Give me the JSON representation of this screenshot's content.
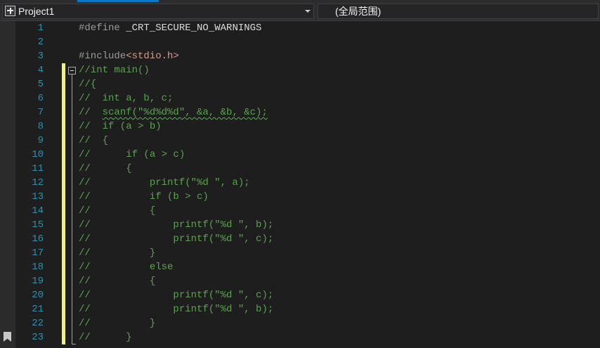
{
  "navigation_bar": {
    "project_label": "Project1",
    "scope_label": "(全局范围)"
  },
  "editor": {
    "lines": [
      {
        "n": "1",
        "tokens": [
          {
            "t": "#define ",
            "c": "kw"
          },
          {
            "t": "_CRT_SECURE_NO_WARNINGS",
            "c": "plain"
          }
        ]
      },
      {
        "n": "2",
        "tokens": []
      },
      {
        "n": "3",
        "tokens": [
          {
            "t": "#include",
            "c": "kw"
          },
          {
            "t": "<stdio.h>",
            "c": "inc"
          }
        ]
      },
      {
        "n": "4",
        "tokens": [
          {
            "t": "//int main()",
            "c": "comment"
          }
        ]
      },
      {
        "n": "5",
        "tokens": [
          {
            "t": "//{",
            "c": "comment"
          }
        ]
      },
      {
        "n": "6",
        "tokens": [
          {
            "t": "//  int a, b, c;",
            "c": "comment"
          }
        ]
      },
      {
        "n": "7",
        "tokens": [
          {
            "t": "//  ",
            "c": "comment"
          },
          {
            "t": "scanf(\"%d%d%d\", &a, &b, &c);",
            "c": "comment",
            "squiggle": true
          }
        ]
      },
      {
        "n": "8",
        "tokens": [
          {
            "t": "//  if (a > b)",
            "c": "comment"
          }
        ]
      },
      {
        "n": "9",
        "tokens": [
          {
            "t": "//  {",
            "c": "comment"
          }
        ]
      },
      {
        "n": "10",
        "tokens": [
          {
            "t": "//      if (a > c)",
            "c": "comment"
          }
        ]
      },
      {
        "n": "11",
        "tokens": [
          {
            "t": "//      {",
            "c": "comment"
          }
        ]
      },
      {
        "n": "12",
        "tokens": [
          {
            "t": "//          printf(\"%d \", a);",
            "c": "comment"
          }
        ]
      },
      {
        "n": "13",
        "tokens": [
          {
            "t": "//          if (b > c)",
            "c": "comment"
          }
        ]
      },
      {
        "n": "14",
        "tokens": [
          {
            "t": "//          {",
            "c": "comment"
          }
        ]
      },
      {
        "n": "15",
        "tokens": [
          {
            "t": "//              printf(\"%d \", b);",
            "c": "comment"
          }
        ]
      },
      {
        "n": "16",
        "tokens": [
          {
            "t": "//              printf(\"%d \", c);",
            "c": "comment"
          }
        ]
      },
      {
        "n": "17",
        "tokens": [
          {
            "t": "//          }",
            "c": "comment"
          }
        ]
      },
      {
        "n": "18",
        "tokens": [
          {
            "t": "//          else",
            "c": "comment"
          }
        ]
      },
      {
        "n": "19",
        "tokens": [
          {
            "t": "//          {",
            "c": "comment"
          }
        ]
      },
      {
        "n": "20",
        "tokens": [
          {
            "t": "//              printf(\"%d \", c);",
            "c": "comment"
          }
        ]
      },
      {
        "n": "21",
        "tokens": [
          {
            "t": "//              printf(\"%d \", b);",
            "c": "comment"
          }
        ]
      },
      {
        "n": "22",
        "tokens": [
          {
            "t": "//          }",
            "c": "comment"
          }
        ]
      },
      {
        "n": "23",
        "tokens": [
          {
            "t": "//      }",
            "c": "comment"
          }
        ]
      }
    ]
  },
  "colors": {
    "editor_background": "#1e1e1e",
    "line_number": "#2b91af",
    "preprocessor": "#9b9b9b",
    "include_path": "#d69d85",
    "comment": "#57a64a",
    "change_indicator": "#efef91"
  },
  "icons": {
    "project": "project-icon",
    "dropdown": "chevron-down-icon",
    "fold": "collapse-minus-icon",
    "bookmark": "bookmark-icon"
  }
}
